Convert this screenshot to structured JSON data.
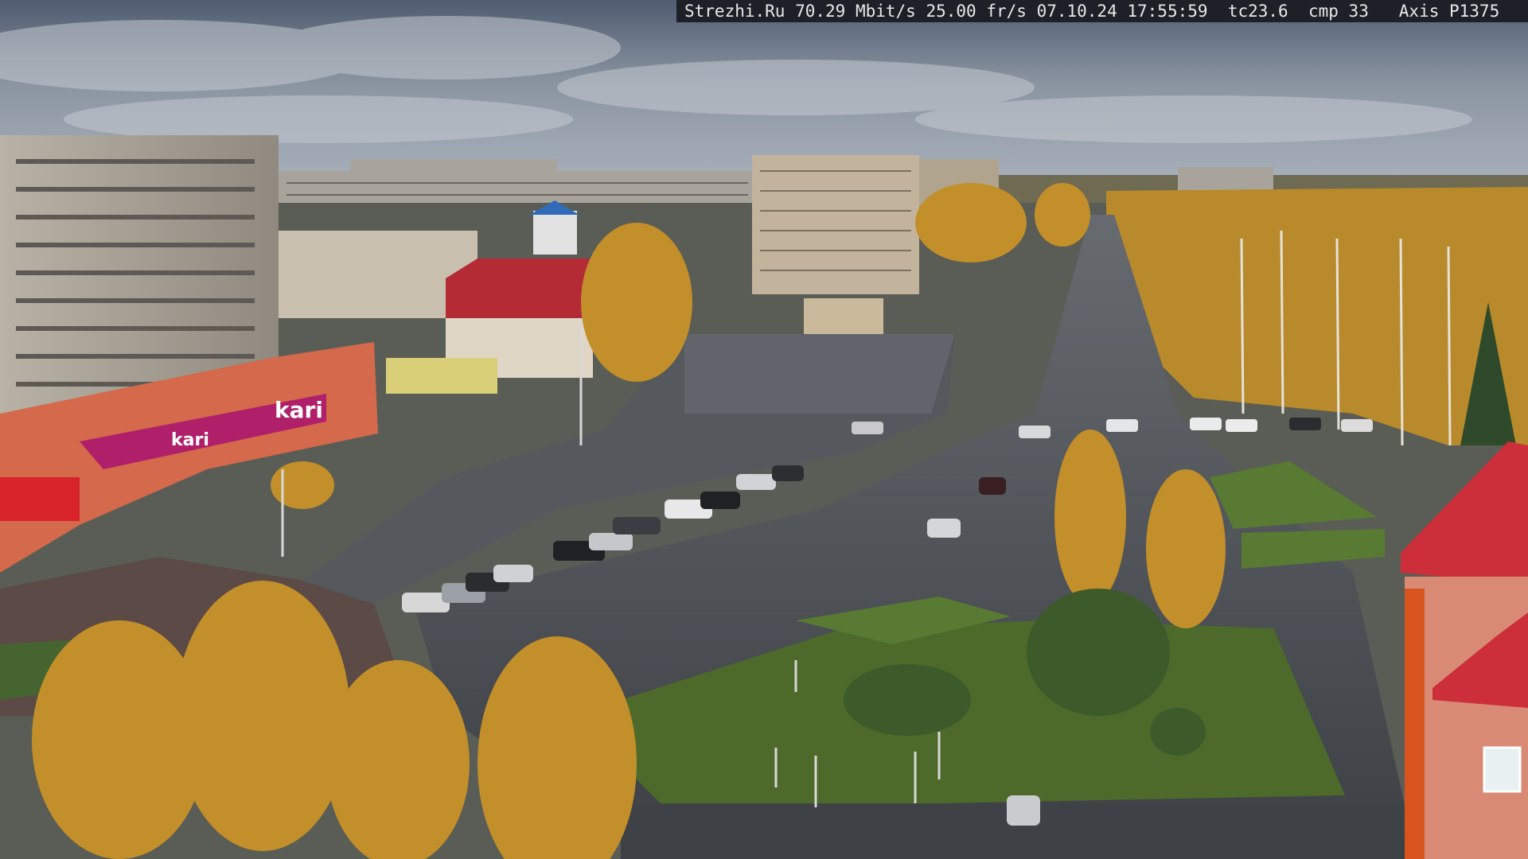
{
  "scene": "webcam-city-view",
  "overlay": {
    "site": "Strezhi.Ru",
    "bitrate": "70.29 Mbit/s",
    "framerate": "25.00 fr/s",
    "date": "07.10.24",
    "time": "17:55:59",
    "tc": "tc23.6",
    "cmp": "cmp 33",
    "camera": "Axis P1375"
  },
  "signs": {
    "store_brand": "kari",
    "store_sign_line": "kari"
  },
  "colors": {
    "sky_top": "#4d5a6e",
    "sky_bottom": "#aab3bd",
    "asphalt": "#4b4e53",
    "grass": "#4f6b2d",
    "autumn_foliage": "#c99a2e",
    "store_facade": "#d46a4c",
    "store_banner": "#b0206a",
    "red_roof": "#c9303a"
  }
}
